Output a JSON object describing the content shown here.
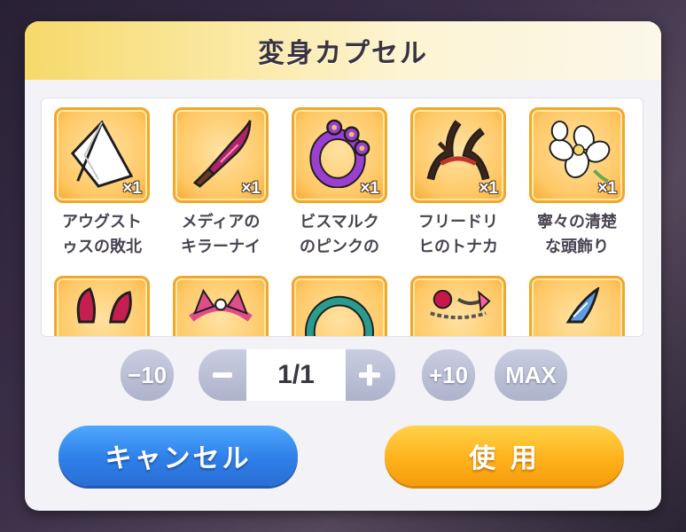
{
  "dialog": {
    "title": "変身カプセル",
    "items": [
      {
        "name": "アウグスト\nゥスの敗北",
        "qty": "×1",
        "icon": "white-flag-icon"
      },
      {
        "name": "メディアの\nキラーナイ",
        "qty": "×1",
        "icon": "killer-knife-icon"
      },
      {
        "name": "ビスマルク\nのピンクの",
        "qty": "×1",
        "icon": "pink-knuckles-icon"
      },
      {
        "name": "フリードリ\nヒのトナカ",
        "qty": "×1",
        "icon": "reindeer-antlers-icon"
      },
      {
        "name": "寧々の清楚\nな頭飾り",
        "qty": "×1",
        "icon": "white-flower-hair-ornament-icon"
      },
      {
        "name": "",
        "qty": "",
        "icon": "bunny-ears-icon"
      },
      {
        "name": "",
        "qty": "",
        "icon": "cat-ear-headband-icon"
      },
      {
        "name": "",
        "qty": "",
        "icon": "teal-choker-icon"
      },
      {
        "name": "",
        "qty": "",
        "icon": "rose-bracelet-icon"
      },
      {
        "name": "",
        "qty": "",
        "icon": "blue-horn-icon"
      }
    ]
  },
  "controls": {
    "minus10_label": "−10",
    "stepper_value": "1/1",
    "plus10_label": "+10",
    "max_label": "MAX"
  },
  "actions": {
    "cancel_label": "キャンセル",
    "use_label": "使 用"
  },
  "colors": {
    "cancel_button": "#2e7fe8",
    "use_button": "#ffb21c",
    "item_frame": "#f0a82c",
    "header_gold": "#f6d96a"
  }
}
